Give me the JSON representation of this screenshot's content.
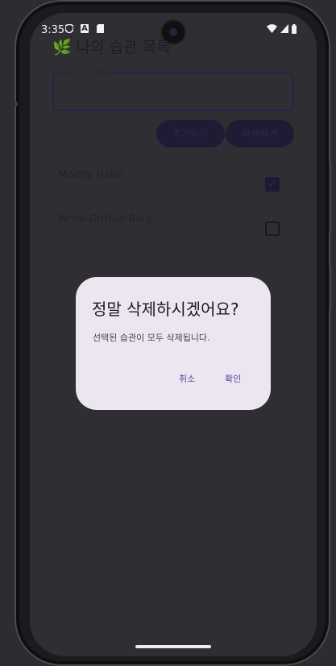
{
  "status": {
    "time": "3:35",
    "icons": [
      "shield-icon",
      "a-icon",
      "sd-card-icon",
      "wifi-icon",
      "signal-icon",
      "battery-icon"
    ]
  },
  "app": {
    "title": "🌿 나의 습관 목록",
    "input": {
      "label": "새 습관 입력",
      "value": ""
    },
    "add_button": "추가하기",
    "delete_button": "삭제하기",
    "habits": [
      {
        "label": "Modify Habit",
        "checked": true
      },
      {
        "label": "Write GitHub Blog",
        "checked": false
      }
    ]
  },
  "dialog": {
    "title": "정말 삭제하시겠어요?",
    "message": "선택된 습관이 모두 삭제됩니다.",
    "cancel": "취소",
    "confirm": "확인"
  },
  "colors": {
    "scrim": "#2f2e32",
    "dialog_bg": "#ece6f0",
    "accent": "#5a3fa1"
  }
}
